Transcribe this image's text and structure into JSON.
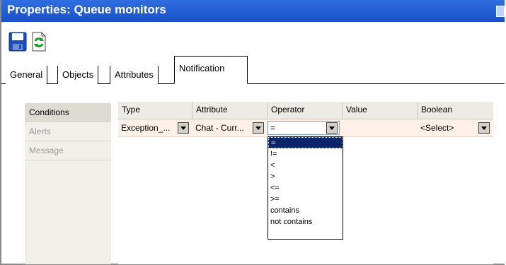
{
  "window": {
    "title": "Properties: Queue monitors"
  },
  "toolbar": {
    "save_icon": "floppy-disk",
    "refresh_icon": "green-refresh"
  },
  "tabs": [
    {
      "label": "General"
    },
    {
      "label": "Objects"
    },
    {
      "label": "Attributes"
    },
    {
      "label": "Notification",
      "active": true
    }
  ],
  "left_nav": [
    {
      "label": "Conditions",
      "active": true
    },
    {
      "label": "Alerts"
    },
    {
      "label": "Message"
    }
  ],
  "grid": {
    "columns": [
      "Type",
      "Attribute",
      "Operator",
      "Value",
      "Boolean"
    ],
    "row": {
      "type": "Exception_...",
      "attribute": "Chat - Curr...",
      "operator": "=",
      "value": "",
      "boolean": "<Select>"
    }
  },
  "operator_dropdown": {
    "options": [
      "=",
      "!=",
      "<",
      ">",
      "<=",
      ">=",
      "contains",
      "not contains"
    ],
    "selected": "="
  },
  "colors": {
    "title_bar": "#1a4fc8",
    "row_bg": "#fff0e8",
    "selection": "#0a246a"
  }
}
